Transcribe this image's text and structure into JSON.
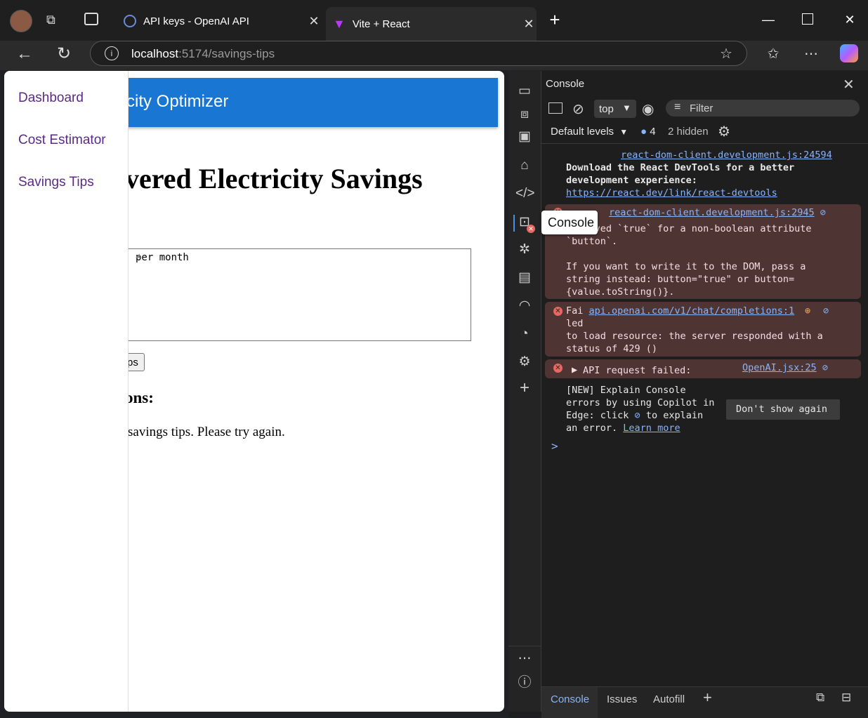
{
  "browser": {
    "tabs": [
      {
        "label": "API keys - OpenAI API",
        "active": false
      },
      {
        "label": "Vite + React",
        "active": true
      }
    ],
    "url_host": "localhost",
    "url_path": ":5174/savings-tips"
  },
  "page": {
    "appbar_title": "city Optimizer",
    "nav": [
      "Dashboard",
      "Cost Estimator",
      "Savings Tips"
    ],
    "heading": "vered Electricity Savings",
    "textarea_text": " per month",
    "button_label": "ps",
    "results_heading": "ons:",
    "error_text": "savings tips. Please try again."
  },
  "devtools": {
    "panel_title": "Console",
    "context": "top",
    "filter_placeholder": "Filter",
    "levels_label": "Default levels",
    "message_count": "4",
    "hidden_label": "2 hidden",
    "tooltip": "Console",
    "messages": {
      "m1_source": "react-dom-client.development.js:24594",
      "m1_text": "Download the React DevTools for a better development experience:",
      "m1_link": "https://react.dev/link/react-devtools",
      "m2_source": "react-dom-client.development.js:2945",
      "m2_text1": "ved `true` for a non-boolean attribute",
      "m2_text2": "`button`.",
      "m2_text3": "If you want to write it to the DOM, pass a",
      "m2_text4": "string instead: button=\"true\" or button=",
      "m2_text5": "{value.toString()}.",
      "m3_prefix": "Fai",
      "m3_source": "api.openai.com/v1/chat/completions:1",
      "m3_text1": "led",
      "m3_text2": "to load resource: the server responded with a",
      "m3_text3": "status of 429 ()",
      "m4_text": "API request failed:",
      "m4_source": "OpenAI.jsx:25"
    },
    "copilot_hint": {
      "line1": "[NEW] Explain Console",
      "line2": "errors by using Copilot in",
      "line3a": "Edge: click",
      "line3b": "to explain",
      "line4": "an error.",
      "learn_more": "Learn more"
    },
    "dont_show_label": "Don't show again",
    "prompt": ">",
    "bottom_tabs": [
      "Console",
      "Issues",
      "Autofill"
    ]
  }
}
